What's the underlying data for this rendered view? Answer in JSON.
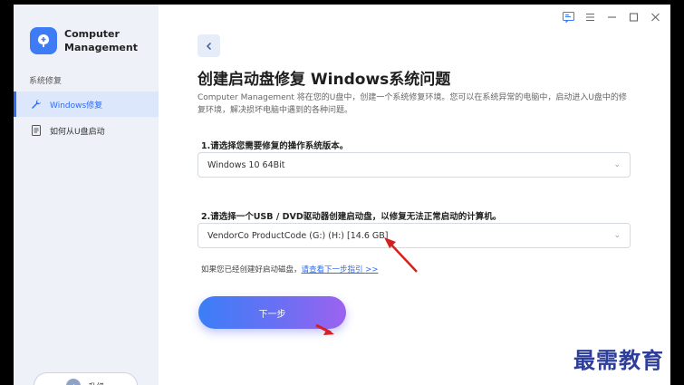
{
  "app": {
    "name": "Computer Management"
  },
  "sidebar": {
    "section_label": "系统修复",
    "items": [
      {
        "label": "Windows修复",
        "icon": "wrench-icon",
        "active": true
      },
      {
        "label": "如何从U盘启动",
        "icon": "document-icon",
        "active": false
      }
    ],
    "upgrade_label": "升级"
  },
  "main": {
    "heading": "创建启动盘修复 Windows系统问题",
    "description": "Computer Management 将在您的U盘中，创建一个系统修复环境。您可以在系统异常的电脑中，启动进入U盘中的修复环境，解决损坏电脑中遇到的各种问题。",
    "step1_label": "1.请选择您需要修复的操作系统版本。",
    "os_select_value": "Windows 10 64Bit",
    "step2_label": "2.请选择一个USB / DVD驱动器创建启动盘，以修复无法正常启动的计算机。",
    "drive_select_value": "VendorCo ProductCode (G:) (H:) [14.6 GB]",
    "hint_text": "如果您已经创建好启动磁盘，",
    "hint_link": "请查看下一步指引 >>",
    "next_label": "下一步"
  },
  "watermark": "最需教育",
  "colors": {
    "accent": "#2f6cf0",
    "annotation_arrow": "#d62020"
  }
}
